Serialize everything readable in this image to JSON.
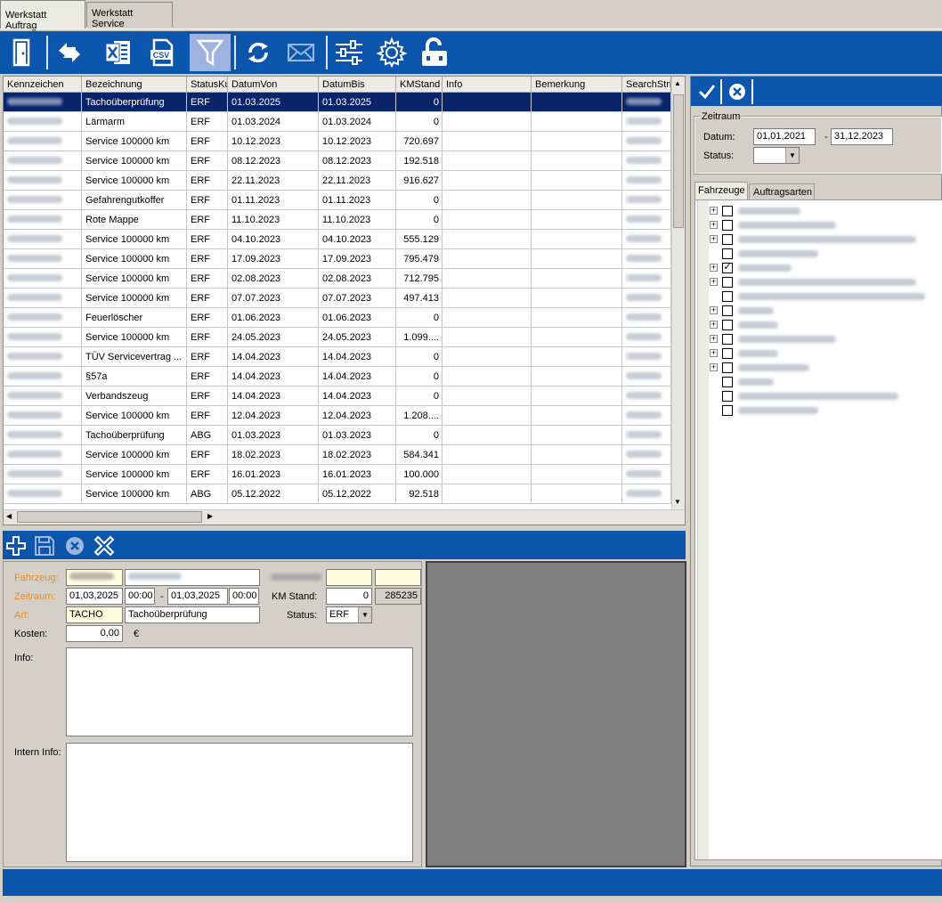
{
  "tabs": [
    {
      "label": "Werkstatt Auftrag"
    },
    {
      "label": "Werkstatt Service"
    }
  ],
  "toolbar": {
    "icons": [
      "exit-door-icon",
      "sync-arrows-icon",
      "excel-export-icon",
      "csv-export-icon",
      "filter-icon",
      "refresh-icon",
      "mail-icon",
      "sliders-icon",
      "gear-icon",
      "unlock-icon"
    ]
  },
  "grid": {
    "columns": [
      "Kennzeichen",
      "Bezeichnung",
      "StatusKu",
      "DatumVon",
      "DatumBis",
      "KMStand",
      "Info",
      "Bemerkung",
      "SearchStrin"
    ],
    "rows": [
      {
        "bez": "Tachoüberprüfung",
        "status": "ERF",
        "von": "01.03.2025",
        "bis": "01.03.2025",
        "km": "0"
      },
      {
        "bez": "Lärmarm",
        "status": "ERF",
        "von": "01.03.2024",
        "bis": "01.03.2024",
        "km": "0"
      },
      {
        "bez": "Service 100000 km",
        "status": "ERF",
        "von": "10.12.2023",
        "bis": "10.12.2023",
        "km": "720.697"
      },
      {
        "bez": "Service 100000 km",
        "status": "ERF",
        "von": "08.12.2023",
        "bis": "08.12.2023",
        "km": "192.518"
      },
      {
        "bez": "Service 100000 km",
        "status": "ERF",
        "von": "22.11.2023",
        "bis": "22.11.2023",
        "km": "916.627"
      },
      {
        "bez": "Gefahrengutkoffer",
        "status": "ERF",
        "von": "01.11.2023",
        "bis": "01.11.2023",
        "km": "0"
      },
      {
        "bez": "Rote Mappe",
        "status": "ERF",
        "von": "11.10.2023",
        "bis": "11.10.2023",
        "km": "0"
      },
      {
        "bez": "Service 100000 km",
        "status": "ERF",
        "von": "04.10.2023",
        "bis": "04.10.2023",
        "km": "555.129"
      },
      {
        "bez": "Service 100000 km",
        "status": "ERF",
        "von": "17.09.2023",
        "bis": "17.09.2023",
        "km": "795.479"
      },
      {
        "bez": "Service 100000 km",
        "status": "ERF",
        "von": "02.08.2023",
        "bis": "02.08.2023",
        "km": "712.795"
      },
      {
        "bez": "Service 100000 km",
        "status": "ERF",
        "von": "07.07.2023",
        "bis": "07.07.2023",
        "km": "497.413"
      },
      {
        "bez": "Feuerlöscher",
        "status": "ERF",
        "von": "01.06.2023",
        "bis": "01.06.2023",
        "km": "0"
      },
      {
        "bez": "Service 100000 km",
        "status": "ERF",
        "von": "24.05.2023",
        "bis": "24.05.2023",
        "km": "1.099...."
      },
      {
        "bez": "TÜV Servicevertrag ...",
        "status": "ERF",
        "von": "14.04.2023",
        "bis": "14.04.2023",
        "km": "0"
      },
      {
        "bez": "§57a",
        "status": "ERF",
        "von": "14.04.2023",
        "bis": "14.04.2023",
        "km": "0"
      },
      {
        "bez": "Verbandszeug",
        "status": "ERF",
        "von": "14.04.2023",
        "bis": "14.04.2023",
        "km": "0"
      },
      {
        "bez": "Service 100000 km",
        "status": "ERF",
        "von": "12.04.2023",
        "bis": "12.04.2023",
        "km": "1.208...."
      },
      {
        "bez": "Tachoüberprüfung",
        "status": "ABG",
        "von": "01.03.2023",
        "bis": "01.03.2023",
        "km": "0"
      },
      {
        "bez": "Service 100000 km",
        "status": "ERF",
        "von": "18.02.2023",
        "bis": "18.02.2023",
        "km": "584.341"
      },
      {
        "bez": "Service 100000 km",
        "status": "ERF",
        "von": "16.01.2023",
        "bis": "16.01.2023",
        "km": "100.000"
      },
      {
        "bez": "Service 100000 km",
        "status": "ABG",
        "von": "05.12.2022",
        "bis": "05.12.2022",
        "km": "92.518"
      }
    ]
  },
  "filter": {
    "group_label": "Zeitraum",
    "datum_label": "Datum:",
    "datum_from": "01,01,2021",
    "dash": "-",
    "datum_to": "31,12,2023",
    "status_label": "Status:",
    "tabs": [
      "Fahrzeuge",
      "Auftragsarten"
    ]
  },
  "detail": {
    "fahrzeug_label": "Fahrzeug:",
    "zeitraum_label": "Zeitraum:",
    "date_from": "01,03,2025",
    "time_from": "00:00",
    "dash": "-",
    "date_to": "01,03,2025",
    "time_to": "00:00",
    "km_label": "KM Stand:",
    "km_value": "0",
    "km_total": "285235",
    "art_label": "Art:",
    "art_code": "TACHO",
    "art_text": "Tachoüberprüfung",
    "status_label": "Status:",
    "status_value": "ERF",
    "kosten_label": "Kosten:",
    "kosten_value": "0,00",
    "currency": "€",
    "info_label": "Info:",
    "intern_label": "Intern Info:"
  }
}
